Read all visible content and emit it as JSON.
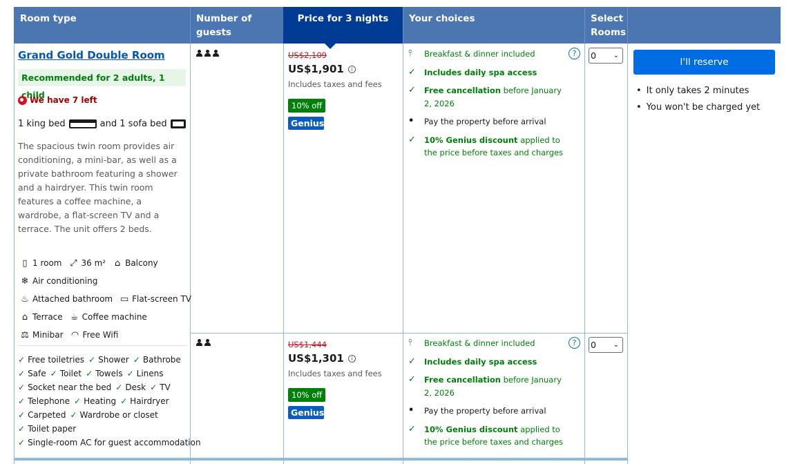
{
  "header": {
    "room_type": "Room type",
    "number_of_guests": "Number of guests",
    "price_for_nights": "Price for 3 nights",
    "your_choices": "Your choices",
    "select_rooms_line1": "Select",
    "select_rooms_line2": "Rooms"
  },
  "room": {
    "title": "Grand Gold Double Room",
    "recommendation": "Recommended for 2 adults, 1 child",
    "availability": "We have 7 left",
    "beds_part1": "1 king bed",
    "beds_part2": "and 1 sofa bed",
    "description": "The spacious twin room provides air conditioning, a mini-bar, as well as a private bathroom featuring a shower and a hairdryer. This twin room features a coffee machine, a wardrobe, a flat-screen TV and a terrace. The unit offers 2 beds.",
    "facilities": [
      [
        {
          "icon": "room-icon",
          "glyph": "▯",
          "label": "1 room"
        },
        {
          "icon": "size-icon",
          "glyph": "⤢",
          "label": "36 m²"
        },
        {
          "icon": "balcony-icon",
          "glyph": "⌂",
          "label": "Balcony"
        }
      ],
      [
        {
          "icon": "air-conditioning-icon",
          "glyph": "❄",
          "label": "Air conditioning"
        }
      ],
      [
        {
          "icon": "bathroom-icon",
          "glyph": "♨",
          "label": "Attached bathroom"
        },
        {
          "icon": "tv-icon",
          "glyph": "▭",
          "label": "Flat-screen TV"
        }
      ],
      [
        {
          "icon": "terrace-icon",
          "glyph": "⌂",
          "label": "Terrace"
        },
        {
          "icon": "coffee-machine-icon",
          "glyph": "☕",
          "label": "Coffee machine"
        }
      ],
      [
        {
          "icon": "minibar-icon",
          "glyph": "⚖",
          "label": "Minibar"
        },
        {
          "icon": "wifi-icon",
          "glyph": "◠",
          "label": "Free Wifi"
        }
      ]
    ],
    "amenities": [
      [
        "Free toiletries",
        "Shower",
        "Bathrobe"
      ],
      [
        "Safe",
        "Toilet",
        "Towels",
        "Linens"
      ],
      [
        "Socket near the bed",
        "Desk",
        "TV"
      ],
      [
        "Telephone",
        "Heating",
        "Hairdryer"
      ],
      [
        "Carpeted",
        "Wardrobe or closet"
      ],
      [
        "Toilet paper"
      ],
      [
        "Single-room AC for guest accommodation"
      ]
    ]
  },
  "options": [
    {
      "guests": 3,
      "old_price": "US$2,109",
      "new_price": "US$1,901",
      "tax_note": "Includes taxes and fees",
      "discount_badge": "10% off",
      "genius_badge": "Genius",
      "choices": {
        "meal": "Breakfast & dinner included",
        "spa": "Includes daily spa access",
        "cancel_bold": "Free cancellation",
        "cancel_rest": " before January 2, 2026",
        "payment": "Pay the property before arrival",
        "genius_bold": "10% Genius discount",
        "genius_rest": " applied to the price before taxes and charges"
      },
      "help_icon": "?",
      "select_value": "0"
    },
    {
      "guests": 2,
      "old_price": "US$1,444",
      "new_price": "US$1,301",
      "tax_note": "Includes taxes and fees",
      "discount_badge": "10% off",
      "genius_badge": "Genius",
      "choices": {
        "meal": "Breakfast & dinner included",
        "spa": "Includes daily spa access",
        "cancel_bold": "Free cancellation",
        "cancel_rest": " before January 2, 2026",
        "payment": "Pay the property before arrival",
        "genius_bold": "10% Genius discount",
        "genius_rest": " applied to the price before taxes and charges"
      },
      "help_icon": "?",
      "select_value": "0"
    }
  ],
  "reserve": {
    "button_label": "I'll reserve",
    "notes": [
      "It only takes 2 minutes",
      "You won't be charged yet"
    ]
  },
  "colors": {
    "header_bg": "#4c76b2",
    "price_header_bg": "#003b95",
    "reserve_button": "#006ce4",
    "green": "#008009",
    "strike_red": "#d4111e"
  }
}
